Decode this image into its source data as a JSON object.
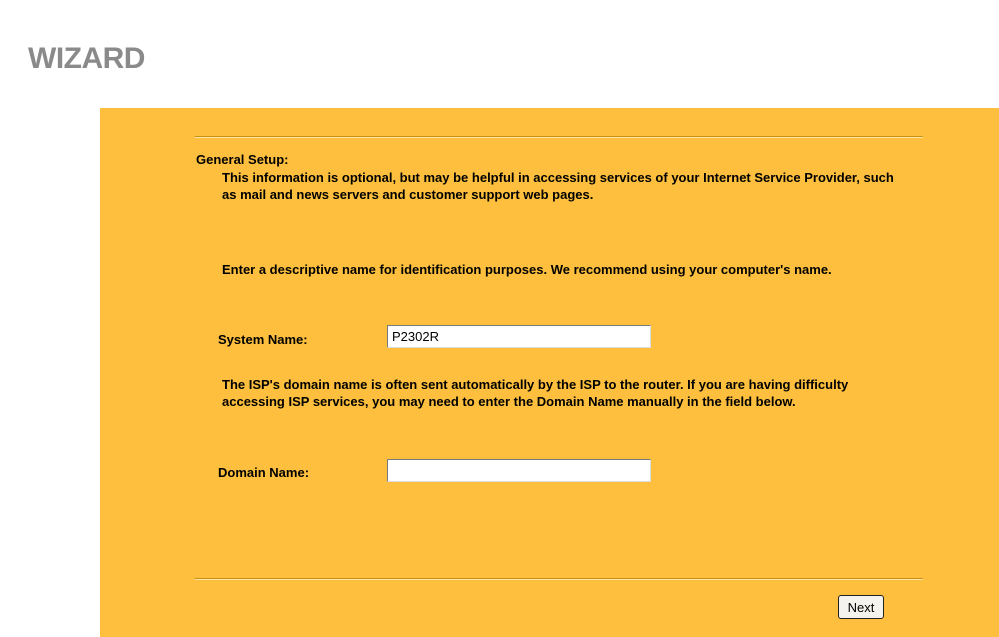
{
  "page": {
    "title": "WIZARD"
  },
  "general_setup": {
    "heading": "General Setup:",
    "intro": "This information is optional, but may be helpful in accessing services of your Internet Service Provider, such as mail and news servers and customer support web pages.",
    "name_instruction": "Enter a descriptive name for identification purposes. We recommend using your computer's name.",
    "system_name": {
      "label": "System Name:",
      "value": "P2302R"
    },
    "domain_instruction": "The ISP's domain name is often sent automatically by the ISP to the router. If you are having difficulty accessing ISP services, you may need to enter the Domain Name manually in the field below.",
    "domain_name": {
      "label": "Domain Name:",
      "value": ""
    }
  },
  "actions": {
    "next_label": "Next"
  },
  "colors": {
    "panel_background": "#fdbf3d",
    "title_gray": "#8a8a8a"
  }
}
